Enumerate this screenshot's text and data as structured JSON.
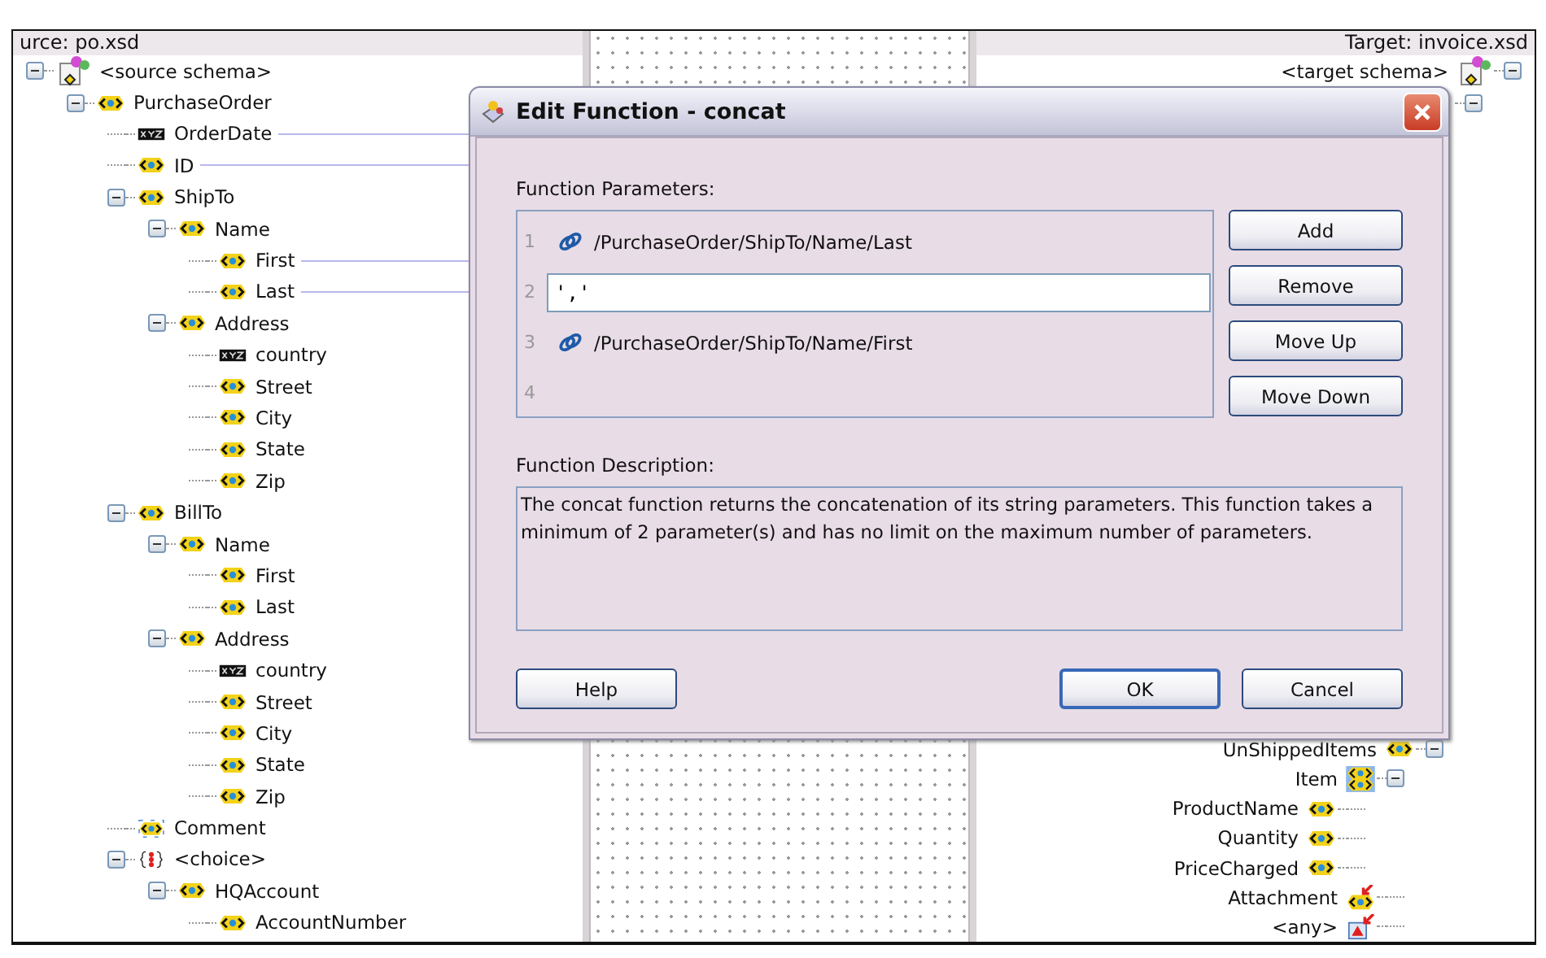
{
  "source_panel": {
    "title": "urce: po.xsd",
    "tree": [
      {
        "label": "<source schema>",
        "kind": "schema",
        "expanded": true,
        "children": [
          {
            "label": "PurchaseOrder",
            "kind": "element",
            "expanded": true,
            "children": [
              {
                "label": "OrderDate",
                "kind": "attribute",
                "mapped": true
              },
              {
                "label": "ID",
                "kind": "element",
                "mapped": true
              },
              {
                "label": "ShipTo",
                "kind": "element",
                "expanded": true,
                "children": [
                  {
                    "label": "Name",
                    "kind": "element",
                    "expanded": true,
                    "children": [
                      {
                        "label": "First",
                        "kind": "element",
                        "mapped": true
                      },
                      {
                        "label": "Last",
                        "kind": "element",
                        "mapped": true
                      }
                    ]
                  },
                  {
                    "label": "Address",
                    "kind": "element",
                    "expanded": true,
                    "children": [
                      {
                        "label": "country",
                        "kind": "attribute",
                        "mapped": false
                      },
                      {
                        "label": "Street",
                        "kind": "element",
                        "mapped": false
                      },
                      {
                        "label": "City",
                        "kind": "element",
                        "mapped": false
                      },
                      {
                        "label": "State",
                        "kind": "element",
                        "mapped": false
                      },
                      {
                        "label": "Zip",
                        "kind": "element",
                        "mapped": false
                      }
                    ]
                  }
                ]
              },
              {
                "label": "BillTo",
                "kind": "element",
                "expanded": true,
                "children": [
                  {
                    "label": "Name",
                    "kind": "element",
                    "expanded": true,
                    "children": [
                      {
                        "label": "First",
                        "kind": "element",
                        "mapped": false
                      },
                      {
                        "label": "Last",
                        "kind": "element",
                        "mapped": false
                      }
                    ]
                  },
                  {
                    "label": "Address",
                    "kind": "element",
                    "expanded": true,
                    "children": [
                      {
                        "label": "country",
                        "kind": "attribute",
                        "mapped": false
                      },
                      {
                        "label": "Street",
                        "kind": "element",
                        "mapped": false
                      },
                      {
                        "label": "City",
                        "kind": "element",
                        "mapped": false
                      },
                      {
                        "label": "State",
                        "kind": "element",
                        "mapped": false
                      },
                      {
                        "label": "Zip",
                        "kind": "element",
                        "mapped": false
                      }
                    ]
                  }
                ]
              },
              {
                "label": "Comment",
                "kind": "optional",
                "mapped": false
              },
              {
                "label": "<choice>",
                "kind": "choice",
                "expanded": true,
                "children": [
                  {
                    "label": "HQAccount",
                    "kind": "element",
                    "expanded": true,
                    "children": [
                      {
                        "label": "AccountNumber",
                        "kind": "element",
                        "mapped": false
                      }
                    ]
                  }
                ]
              }
            ]
          }
        ]
      }
    ]
  },
  "target_panel": {
    "title": "Target: invoice.xsd",
    "tree": [
      {
        "label": "<target schema>",
        "kind": "schema",
        "expanded": true,
        "children": [
          {
            "expanded": true,
            "children": [
              {
                "label": "UnShippedItems",
                "kind": "element",
                "expanded": true,
                "children": [
                  {
                    "label": "Item",
                    "kind": "repeating",
                    "expanded": true,
                    "children": [
                      {
                        "label": "ProductName",
                        "kind": "element"
                      },
                      {
                        "label": "Quantity",
                        "kind": "element"
                      },
                      {
                        "label": "PriceCharged",
                        "kind": "element"
                      }
                    ]
                  },
                  {
                    "label": "Attachment",
                    "kind": "reference"
                  },
                  {
                    "label": "<any>",
                    "kind": "any"
                  }
                ]
              }
            ]
          }
        ]
      }
    ]
  },
  "dialog": {
    "title": "Edit Function - concat",
    "parameters_label": "Function Parameters:",
    "parameters": [
      {
        "number": "1",
        "kind": "path",
        "text": "/PurchaseOrder/ShipTo/Name/Last"
      },
      {
        "number": "2",
        "kind": "input",
        "value": "','"
      },
      {
        "number": "3",
        "kind": "path",
        "text": "/PurchaseOrder/ShipTo/Name/First"
      },
      {
        "number": "4",
        "kind": "empty"
      }
    ],
    "side_buttons": [
      "Add",
      "Remove",
      "Move Up",
      "Move Down"
    ],
    "description_label": "Function Description:",
    "description": "The concat function returns the concatenation of its string parameters. This function takes a minimum of 2 parameter(s) and has no limit on the maximum number of parameters.",
    "footer_left_buttons": [
      {
        "label": "Help",
        "default": false
      }
    ],
    "footer_right_buttons": [
      {
        "label": "OK",
        "default": true
      },
      {
        "label": "Cancel",
        "default": false
      }
    ]
  }
}
